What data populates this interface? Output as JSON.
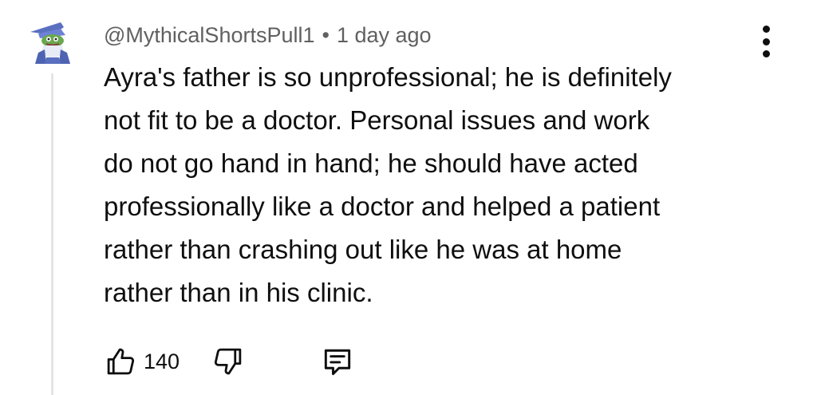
{
  "comment": {
    "author": "@MythicalShortsPull1",
    "separator": "•",
    "time_ago": "1 day ago",
    "text_lines": [
      "Ayra's father is so unprofessional; he is definitely",
      "not fit to be a doctor. Personal issues and work",
      "do not go hand in hand; he should have acted",
      "professionally like a doctor and helped a patient",
      "rather than crashing out like he was at home",
      "rather than in his clinic."
    ],
    "like_count": "140"
  },
  "icons": {
    "avatar": "wizard-frog-avatar",
    "menu": "more-vertical-icon",
    "like": "thumbs-up-icon",
    "dislike": "thumbs-down-icon",
    "reply": "reply-comment-icon"
  },
  "colors": {
    "text": "#0f0f0f",
    "meta": "#606060",
    "thread_line": "#e5e5e5",
    "avatar_hat": "#5a6fc0",
    "avatar_face": "#6aa84f"
  }
}
